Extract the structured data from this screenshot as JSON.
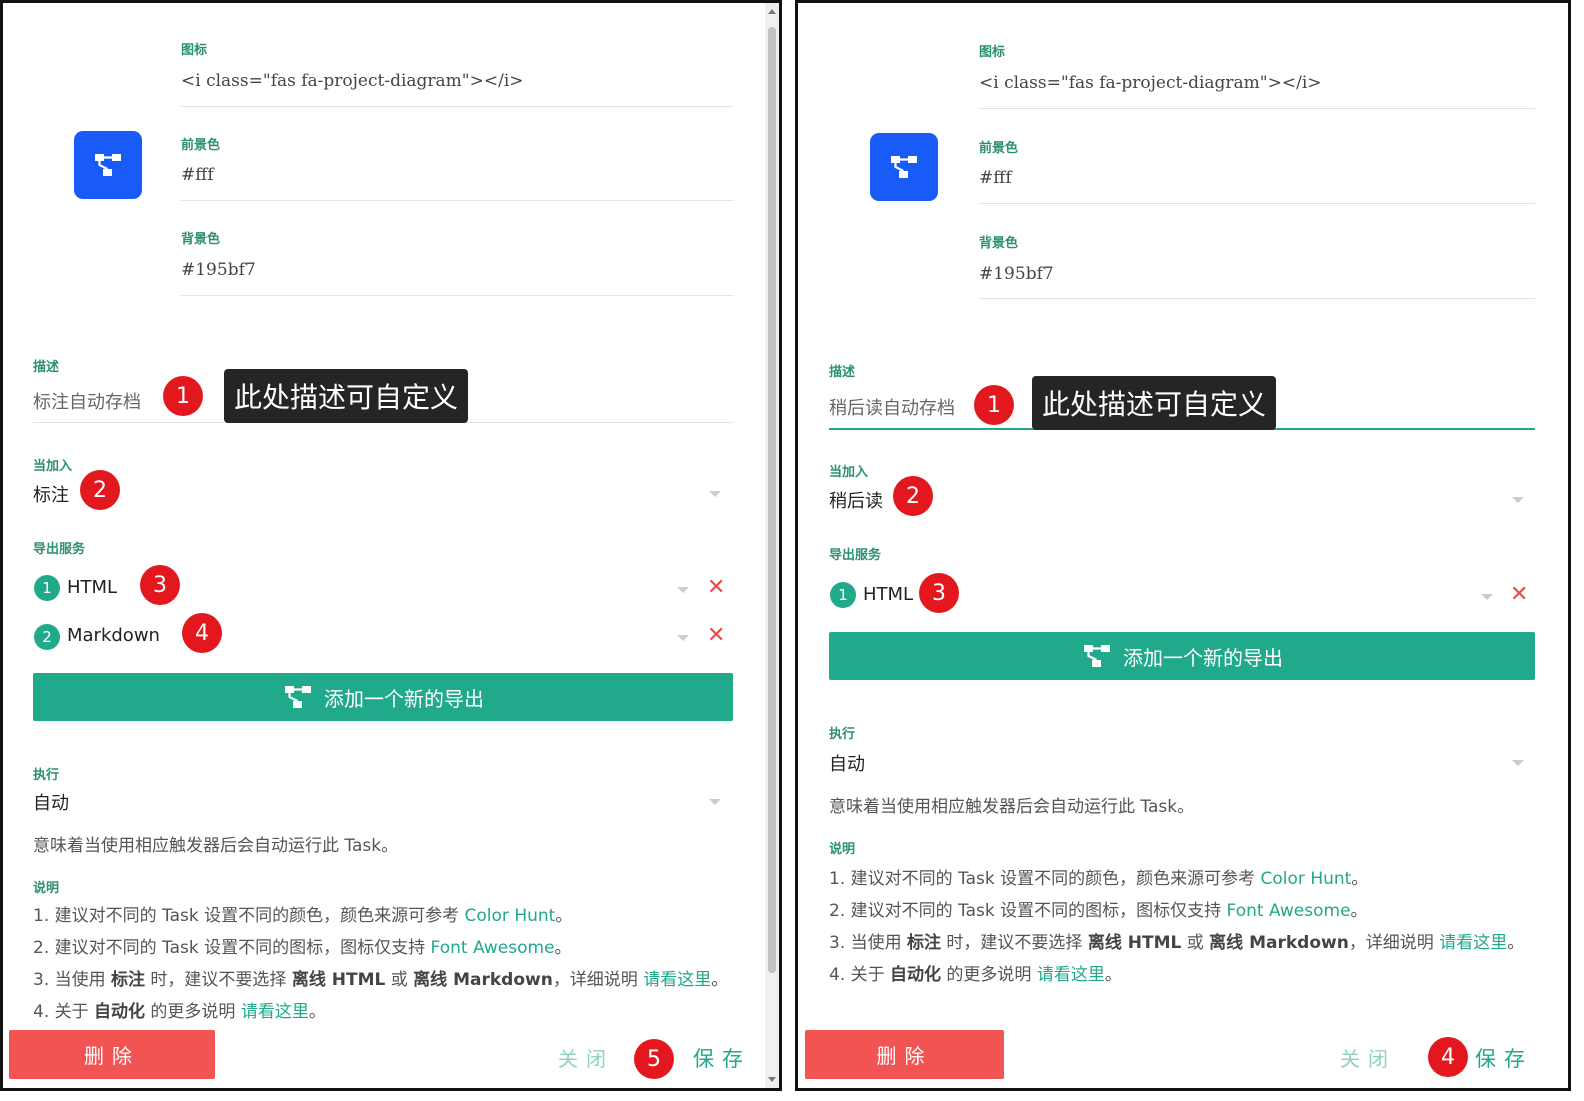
{
  "left": {
    "icon": {
      "label": "图标",
      "value": "<i class=\"fas fa-project-diagram\"></i>"
    },
    "foreground": {
      "label": "前景色",
      "value": "#fff"
    },
    "background": {
      "label": "背景色",
      "value": "#195bf7"
    },
    "preview_icon": "project-diagram-icon",
    "preview_colors": {
      "fg": "#ffffff",
      "bg": "#195bf7"
    },
    "description": {
      "label": "描述",
      "value": "标注自动存档"
    },
    "callout": "此处描述可自定义",
    "trigger": {
      "label": "当加入",
      "value": "标注"
    },
    "export": {
      "label": "导出服务",
      "items": [
        {
          "num": "1",
          "name": "HTML"
        },
        {
          "num": "2",
          "name": "Markdown"
        }
      ],
      "add_label": "添加一个新的导出"
    },
    "execute": {
      "label": "执行",
      "value": "自动",
      "help": "意味着当使用相应触发器后会自动运行此 Task。"
    },
    "notes": {
      "label": "说明",
      "row1": {
        "prefix": "1. 建议对不同的 Task 设置不同的颜色，颜色来源可参考 ",
        "link": "Color Hunt",
        "suffix": "。"
      },
      "row2": {
        "prefix": "2. 建议对不同的 Task 设置不同的图标，图标仅支持 ",
        "link": "Font Awesome",
        "suffix": "。"
      },
      "row3": {
        "p1": "3. 当使用 ",
        "b1": "标注",
        "p2": " 时，建议不要选择 ",
        "b2": "离线 HTML",
        "p3": " 或 ",
        "b3": "离线 Markdown",
        "p4": "，详细说明 ",
        "link": "请看这里",
        "suffix": "。"
      },
      "row4": {
        "p1": "4. 关于 ",
        "b1": "自动化",
        "p2": " 的更多说明 ",
        "link": "请看这里",
        "suffix": "。"
      }
    },
    "footer": {
      "delete": "删除",
      "close": "关闭",
      "save": "保存"
    },
    "markers": [
      "1",
      "2",
      "3",
      "4",
      "5"
    ]
  },
  "right": {
    "icon": {
      "label": "图标",
      "value": "<i class=\"fas fa-project-diagram\"></i>"
    },
    "foreground": {
      "label": "前景色",
      "value": "#fff"
    },
    "background": {
      "label": "背景色",
      "value": "#195bf7"
    },
    "preview_icon": "project-diagram-icon",
    "preview_colors": {
      "fg": "#ffffff",
      "bg": "#195bf7"
    },
    "description": {
      "label": "描述",
      "value": "稍后读自动存档"
    },
    "callout": "此处描述可自定义",
    "trigger": {
      "label": "当加入",
      "value": "稍后读"
    },
    "export": {
      "label": "导出服务",
      "items": [
        {
          "num": "1",
          "name": "HTML"
        }
      ],
      "add_label": "添加一个新的导出"
    },
    "execute": {
      "label": "执行",
      "value": "自动",
      "help": "意味着当使用相应触发器后会自动运行此 Task。"
    },
    "notes": {
      "label": "说明",
      "row1": {
        "prefix": "1. 建议对不同的 Task 设置不同的颜色，颜色来源可参考 ",
        "link": "Color Hunt",
        "suffix": "。"
      },
      "row2": {
        "prefix": "2. 建议对不同的 Task 设置不同的图标，图标仅支持 ",
        "link": "Font Awesome",
        "suffix": "。"
      },
      "row3": {
        "p1": "3. 当使用 ",
        "b1": "标注",
        "p2": " 时，建议不要选择 ",
        "b2": "离线 HTML",
        "p3": " 或 ",
        "b3": "离线 Markdown",
        "p4": "，详细说明 ",
        "link": "请看这里",
        "suffix": "。"
      },
      "row4": {
        "p1": "4. 关于 ",
        "b1": "自动化",
        "p2": " 的更多说明 ",
        "link": "请看这里",
        "suffix": "。"
      }
    },
    "footer": {
      "delete": "删除",
      "close": "关闭",
      "save": "保存"
    },
    "markers": [
      "1",
      "2",
      "3",
      "4"
    ]
  },
  "colors": {
    "accent": "#20a98a",
    "danger": "#f25454",
    "marker": "#e3181f",
    "icon_bg": "#195bf7"
  }
}
